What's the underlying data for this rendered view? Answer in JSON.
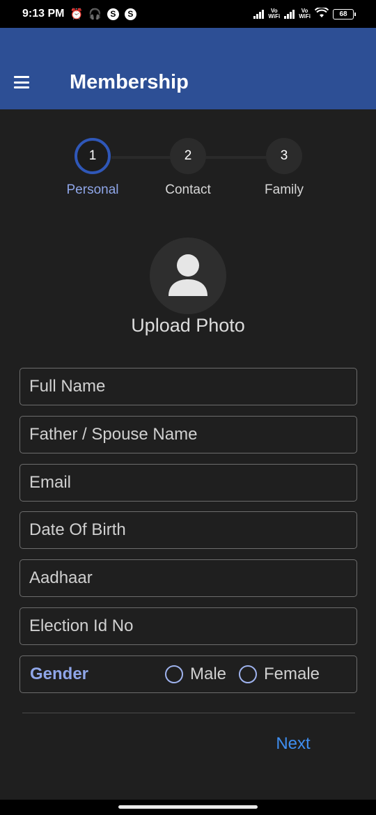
{
  "status_bar": {
    "time": "9:13 PM",
    "alarm_icon": "alarm-icon",
    "headset_icon": "headset-icon",
    "skype_badge_1": "S",
    "skype_badge_2": "S",
    "vowifi_1": "Vo WiFi",
    "vowifi_2": "Vo WiFi",
    "battery": "68"
  },
  "app_bar": {
    "title": "Membership",
    "menu_icon": "menu-icon"
  },
  "stepper": {
    "steps": [
      {
        "number": "1",
        "label": "Personal",
        "active": true
      },
      {
        "number": "2",
        "label": "Contact",
        "active": false
      },
      {
        "number": "3",
        "label": "Family",
        "active": false
      }
    ],
    "active_color": "#2f57b8"
  },
  "photo": {
    "icon": "person-icon",
    "label": "Upload Photo"
  },
  "form": {
    "full_name": {
      "placeholder": "Full Name",
      "value": ""
    },
    "father_spouse_name": {
      "placeholder": "Father / Spouse Name",
      "value": ""
    },
    "email": {
      "placeholder": "Email",
      "value": ""
    },
    "date_of_birth": {
      "placeholder": "Date Of Birth",
      "value": ""
    },
    "aadhaar": {
      "placeholder": "Aadhaar",
      "value": ""
    },
    "election_id": {
      "placeholder": "Election Id No",
      "value": ""
    },
    "gender": {
      "label": "Gender",
      "options": [
        "Male",
        "Female"
      ],
      "selected": ""
    }
  },
  "actions": {
    "next_label": "Next",
    "next_color": "#3f8ef0"
  },
  "theme": {
    "app_bar_color": "#2d4f95",
    "background": "#1f1f1f",
    "accent_label": "#8fa6e8"
  }
}
